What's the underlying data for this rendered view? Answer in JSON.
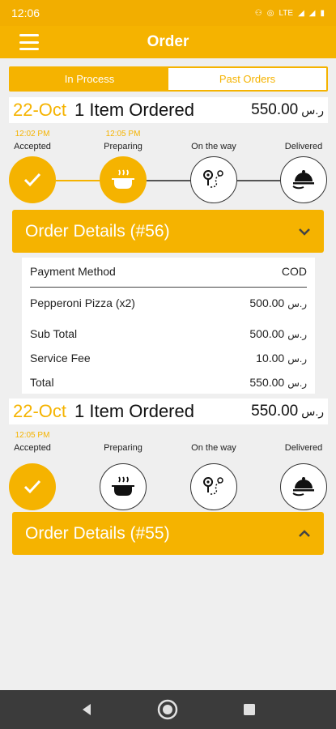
{
  "status": {
    "time": "12:06",
    "lte": "LTE"
  },
  "appbar": {
    "title": "Order"
  },
  "tabs": [
    {
      "label": "In Process",
      "active": true
    },
    {
      "label": "Past Orders",
      "active": false
    }
  ],
  "orders": [
    {
      "date": "22-Oct",
      "items_text": "1 Item Ordered",
      "price": "550.00",
      "currency": "ر.س",
      "steps": [
        {
          "label": "Accepted",
          "time": "12:02 PM",
          "done": true
        },
        {
          "label": "Preparing",
          "time": "12:05 PM",
          "done": true
        },
        {
          "label": "On the way",
          "time": "",
          "done": false
        },
        {
          "label": "Delivered",
          "time": "",
          "done": false
        }
      ],
      "details_title": "Order Details (#56)",
      "expanded": true,
      "details": {
        "payment_label": "Payment Method",
        "payment_value": "COD",
        "items": [
          {
            "name": "Pepperoni Pizza (x2)",
            "amount": "500.00"
          }
        ],
        "subtotal_label": "Sub Total",
        "subtotal": "500.00",
        "fee_label": "Service Fee",
        "fee": "10.00",
        "total_label": "Total",
        "total": "550.00"
      }
    },
    {
      "date": "22-Oct",
      "items_text": "1 Item Ordered",
      "price": "550.00",
      "currency": "ر.س",
      "steps": [
        {
          "label": "Accepted",
          "time": "12:05 PM",
          "done": true
        },
        {
          "label": "Preparing",
          "time": "",
          "done": false
        },
        {
          "label": "On the way",
          "time": "",
          "done": false
        },
        {
          "label": "Delivered",
          "time": "",
          "done": false
        }
      ],
      "details_title": "Order Details (#55)",
      "expanded": false
    }
  ],
  "colors": {
    "accent": "#f5b300",
    "background": "#efefef",
    "navbar": "#3b3b3b"
  }
}
